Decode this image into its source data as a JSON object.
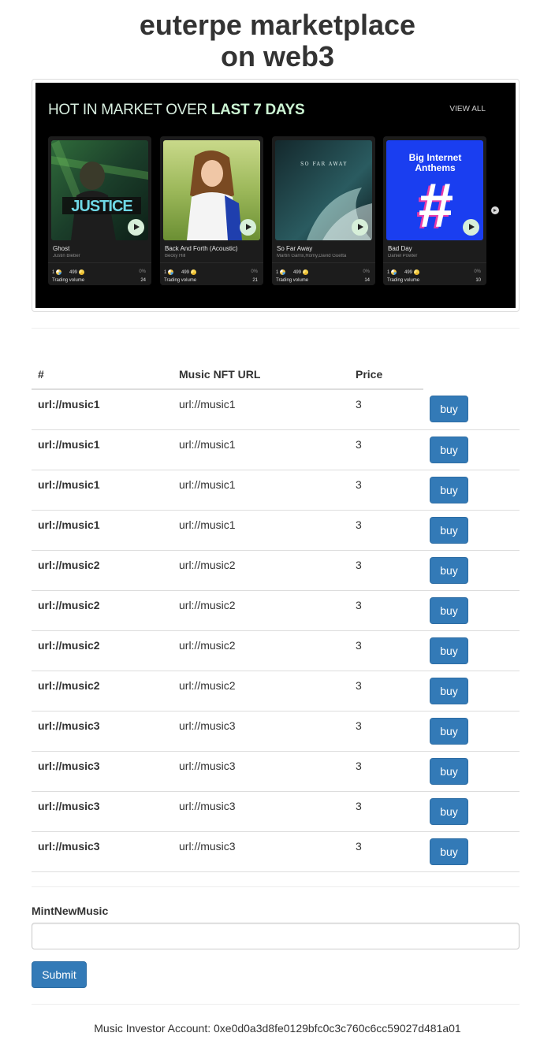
{
  "header": {
    "title_line1": "euterpe marketplace",
    "title_line2": "on web3"
  },
  "banner": {
    "heading_prefix": "HOT IN MARKET OVER ",
    "heading_emphasis": "LAST 7 DAYS",
    "view_all": "VIEW ALL",
    "cards": [
      {
        "title": "Ghost",
        "artist": "Justin Bieber",
        "holders": "1",
        "count": "499",
        "percent": "0%",
        "volume_label": "Trading volume",
        "volume": "24"
      },
      {
        "title": "Back And Forth (Acoustic)",
        "artist": "Becky Hill",
        "holders": "1",
        "count": "499",
        "percent": "0%",
        "volume_label": "Trading volume",
        "volume": "21"
      },
      {
        "title": "So Far Away",
        "artist": "Martin Garrix,Romy,David Guetta",
        "holders": "1",
        "count": "499",
        "percent": "0%",
        "volume_label": "Trading volume",
        "volume": "14",
        "art_text": "SO FAR AWAY"
      },
      {
        "title": "Bad Day",
        "artist": "Daniel Powter",
        "holders": "1",
        "count": "499",
        "percent": "0%",
        "volume_label": "Trading volume",
        "volume": "10",
        "art_text_1": "Big Internet",
        "art_text_2": "Anthems",
        "art_text_3": "#"
      }
    ]
  },
  "table": {
    "headers": [
      "#",
      "Music NFT URL",
      "Price",
      ""
    ],
    "buy_label": "buy",
    "rows": [
      {
        "id": "url://music1",
        "url": "url://music1",
        "price": "3"
      },
      {
        "id": "url://music1",
        "url": "url://music1",
        "price": "3"
      },
      {
        "id": "url://music1",
        "url": "url://music1",
        "price": "3"
      },
      {
        "id": "url://music1",
        "url": "url://music1",
        "price": "3"
      },
      {
        "id": "url://music2",
        "url": "url://music2",
        "price": "3"
      },
      {
        "id": "url://music2",
        "url": "url://music2",
        "price": "3"
      },
      {
        "id": "url://music2",
        "url": "url://music2",
        "price": "3"
      },
      {
        "id": "url://music2",
        "url": "url://music2",
        "price": "3"
      },
      {
        "id": "url://music3",
        "url": "url://music3",
        "price": "3"
      },
      {
        "id": "url://music3",
        "url": "url://music3",
        "price": "3"
      },
      {
        "id": "url://music3",
        "url": "url://music3",
        "price": "3"
      },
      {
        "id": "url://music3",
        "url": "url://music3",
        "price": "3"
      }
    ]
  },
  "mint": {
    "label": "MintNewMusic",
    "value": "",
    "submit_label": "Submit"
  },
  "footer": {
    "account_text": "Music Investor Account: 0xe0d0a3d8fe0129bfc0c3c760c6cc59027d481a01"
  },
  "colors": {
    "primary": "#337ab7",
    "banner_bg": "#000000",
    "accent_green": "#ccf5d3"
  }
}
